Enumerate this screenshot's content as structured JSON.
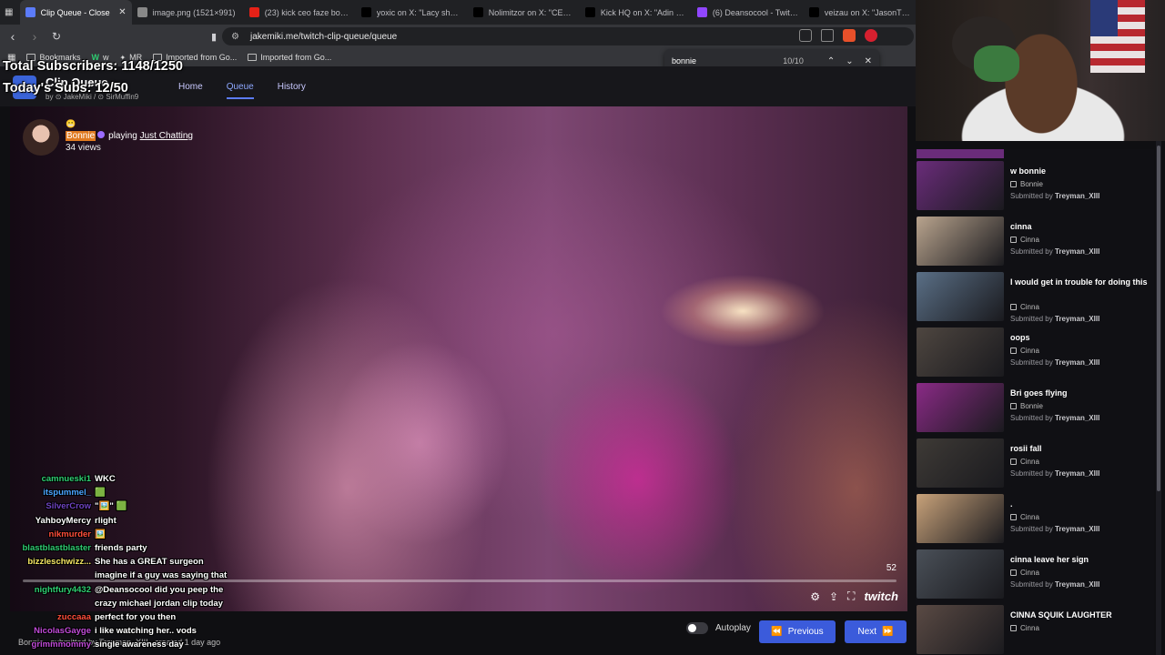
{
  "tabs": [
    {
      "label": "Clip Queue - Close",
      "active": true,
      "favicon_color": "#5c7cfa"
    },
    {
      "label": "image.png (1521×991)",
      "favicon_color": "#888888"
    },
    {
      "label": "(23) kick ceo faze botting",
      "favicon_color": "#e62117"
    },
    {
      "label": "yoxic on X: \"Lacy shuts do",
      "favicon_color": "#000000"
    },
    {
      "label": "Nolimitzor on X: \"CEO of K",
      "favicon_color": "#000000"
    },
    {
      "label": "Kick HQ on X: \"Adin Ross",
      "favicon_color": "#000000"
    },
    {
      "label": "(6) Deansocool - Twitch",
      "favicon_color": "#9146ff"
    },
    {
      "label": "veizau on X: \"JasonTheWe",
      "favicon_color": "#000000"
    }
  ],
  "address": {
    "url": "jakemiki.me/twitch-clip-queue/queue"
  },
  "bookmarks": [
    {
      "label": "Bookmarks"
    },
    {
      "label": "w"
    },
    {
      "label": "MR"
    },
    {
      "label": "Imported from Go..."
    },
    {
      "label": "Imported from Go..."
    }
  ],
  "find": {
    "query": "bonnie",
    "count": "10/10"
  },
  "overlay": {
    "total_subs": "Total Subscribers: 1148/1250",
    "todays_subs": "Today's Subs: 12/50"
  },
  "app": {
    "title": "Clip Queue",
    "by_prefix": "by",
    "author1": "JakeMiki",
    "author2": "SirMuffin9",
    "nav": [
      {
        "label": "Home"
      },
      {
        "label": "Queue",
        "active": true
      },
      {
        "label": "History"
      }
    ]
  },
  "player": {
    "streamer": "Bonnie",
    "playing_text": "playing",
    "game": "Just Chatting",
    "views": "34 views",
    "duration": "52",
    "twitch_label": "twitch"
  },
  "chat": [
    {
      "user": "camnueski1",
      "color": "#2ecc71",
      "msg": "WKC"
    },
    {
      "user": "itspummel_",
      "color": "#4aa3ff",
      "msg": "🟩"
    },
    {
      "user": "SilverCrow",
      "color": "#6f42c1",
      "msg": "\"🖼️\" 🟩"
    },
    {
      "user": "YahboyMercy",
      "color": "#ffffff",
      "msg": "rlight"
    },
    {
      "user": "nikmurder",
      "color": "#ff4d3a",
      "msg": "🖼️"
    },
    {
      "user": "blastblastblaster",
      "color": "#2ecc71",
      "msg": "friends party"
    },
    {
      "user": "bizzleschwizz...",
      "color": "#f5e663",
      "msg": "She has a GREAT surgeon"
    },
    {
      "user": "",
      "color": "#ffffff",
      "msg": "imagine if a guy was saying that"
    },
    {
      "user": "nightfury4432",
      "color": "#2ecc71",
      "msg": "@Deansocool did you peep the"
    },
    {
      "user": "",
      "color": "#ffffff",
      "msg": "crazy michael jordan clip today"
    },
    {
      "user": "zuccaaa",
      "color": "#ff4d3a",
      "msg": "perfect for you then"
    },
    {
      "user": "NicolasGayge",
      "color": "#c04bd8",
      "msg": "i like watching her.. vods"
    },
    {
      "user": "grimmmommy",
      "color": "#c04bd8",
      "msg": "single awareness day"
    }
  ],
  "bottom": {
    "clip_info": "Bonnie , submitted by Treyman_XIII , created 1 day ago",
    "autoplay_label": "Autoplay",
    "prev_label": "Previous",
    "next_label": "Next"
  },
  "queue": [
    {
      "title": "w bonnie",
      "channel": "Bonnie",
      "submitted_prefix": "Submitted by",
      "submitter": "Treyman_XIII",
      "thumb": "#6a2c7a"
    },
    {
      "title": "cinna",
      "channel": "Cinna",
      "submitted_prefix": "Submitted by",
      "submitter": "Treyman_XIII",
      "thumb": "#b9a48e"
    },
    {
      "title": "I would get in trouble for doing this",
      "channel": "Cinna",
      "submitted_prefix": "Submitted by",
      "submitter": "Treyman_XIII",
      "thumb": "#5a6f86"
    },
    {
      "title": "oops",
      "channel": "Cinna",
      "submitted_prefix": "Submitted by",
      "submitter": "Treyman_XIII",
      "thumb": "#4e4640"
    },
    {
      "title": "Bri goes flying",
      "channel": "Bonnie",
      "submitted_prefix": "Submitted by",
      "submitter": "Treyman_XIII",
      "thumb": "#8a2a86"
    },
    {
      "title": "rosii fall",
      "channel": "Cinna",
      "submitted_prefix": "Submitted by",
      "submitter": "Treyman_XIII",
      "thumb": "#3e3a36"
    },
    {
      "title": ".",
      "channel": "Cinna",
      "submitted_prefix": "Submitted by",
      "submitter": "Treyman_XIII",
      "thumb": "#c8a27a"
    },
    {
      "title": "cinna leave her sign",
      "channel": "Cinna",
      "submitted_prefix": "Submitted by",
      "submitter": "Treyman_XIII",
      "thumb": "#4a5058"
    },
    {
      "title": "CINNA SQUIK LAUGHTER",
      "channel": "Cinna",
      "submitted_prefix": "",
      "submitter": "",
      "thumb": "#5a4a44"
    }
  ],
  "colors": {
    "accent": "#3b5bdb",
    "highlight": "#e07a20"
  }
}
